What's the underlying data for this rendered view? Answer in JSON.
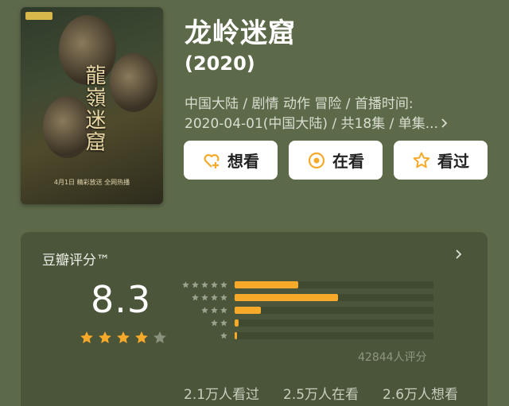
{
  "movie": {
    "title": "龙岭迷窟",
    "year": "(2020)",
    "meta_line1": "中国大陆 / 剧情 动作 冒险 / 首播时间:",
    "meta_line2": "2020-04-01(中国大陆) / 共18集 / 单集...",
    "poster": {
      "calligraphy": "龍嶺迷窟",
      "tagline": "4月1日 精彩放送 全网热播"
    }
  },
  "actions": {
    "want": "想看",
    "watching": "在看",
    "watched": "看过"
  },
  "rating": {
    "title": "豆瓣评分™",
    "score": "8.3",
    "star_level": 4,
    "distribution": [
      {
        "stars": 5,
        "fraction": 0.32
      },
      {
        "stars": 4,
        "fraction": 0.52
      },
      {
        "stars": 3,
        "fraction": 0.13
      },
      {
        "stars": 2,
        "fraction": 0.02
      },
      {
        "stars": 1,
        "fraction": 0.01
      }
    ],
    "count_text": "42844人评分"
  },
  "watch_stats": {
    "watched": "2.1万人看过",
    "watching": "2.5万人在看",
    "want": "2.6万人想看"
  },
  "colors": {
    "background": "#5d6a4a",
    "card": "#4a553a",
    "accent": "#f7a929",
    "star_off": "#8a917c"
  }
}
